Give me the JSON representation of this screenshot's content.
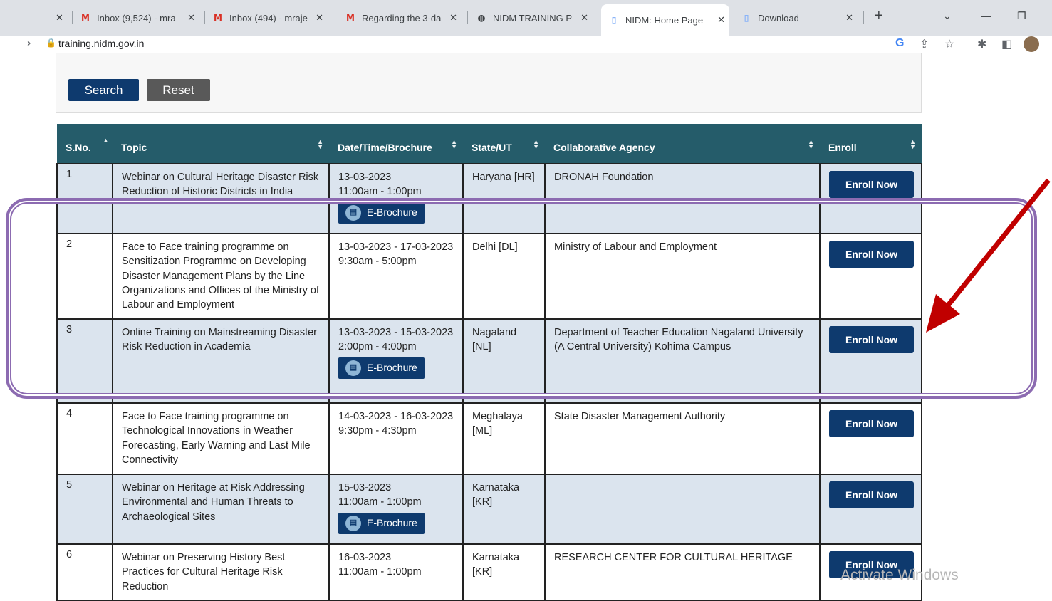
{
  "browser": {
    "tabs": [
      {
        "title": "Inbox (9,524) - mra",
        "icon": "gmail-icon"
      },
      {
        "title": "Inbox (494) - mraje",
        "icon": "gmail-icon"
      },
      {
        "title": "Regarding the 3-da",
        "icon": "gmail-icon"
      },
      {
        "title": "NIDM TRAINING P",
        "icon": "globe-icon"
      },
      {
        "title": "NIDM: Home Page",
        "icon": "page-icon"
      },
      {
        "title": "Download",
        "icon": "page-icon"
      }
    ],
    "url": "training.nidm.gov.in"
  },
  "search": {
    "search_label": "Search",
    "reset_label": "Reset"
  },
  "table": {
    "headers": [
      "S.No.",
      "Topic",
      "Date/Time/Brochure",
      "State/UT",
      "Collaborative Agency",
      "Enroll"
    ],
    "enroll_label": "Enroll Now",
    "brochure_label": "E-Brochure",
    "rows": [
      {
        "sno": "1",
        "topic": "Webinar on Cultural Heritage Disaster Risk Reduction of Historic Districts in India",
        "date": "13-03-2023",
        "time": "11:00am - 1:00pm",
        "brochure": true,
        "state": "Haryana [HR]",
        "agency": "DRONAH Foundation"
      },
      {
        "sno": "2",
        "topic": "Face to Face training programme on Sensitization Programme on Developing Disaster Management Plans by the Line Organizations and Offices of the Ministry of Labour and Employment",
        "date": "13-03-2023 - 17-03-2023",
        "time": "9:30am - 5:00pm",
        "brochure": false,
        "state": "Delhi [DL]",
        "agency": "Ministry of Labour and Employment"
      },
      {
        "sno": "3",
        "topic": "Online Training on Mainstreaming Disaster Risk Reduction in Academia",
        "date": "13-03-2023 - 15-03-2023",
        "time": "2:00pm - 4:00pm",
        "brochure": true,
        "state": "Nagaland [NL]",
        "agency": "Department of Teacher Education Nagaland University (A Central University) Kohima Campus"
      },
      {
        "sno": "4",
        "topic": "Face to Face training programme on Technological Innovations in Weather Forecasting, Early Warning and Last Mile Connectivity",
        "date": "14-03-2023 - 16-03-2023",
        "time": "9:30pm - 4:30pm",
        "brochure": false,
        "state": "Meghalaya [ML]",
        "agency": "State Disaster Management Authority"
      },
      {
        "sno": "5",
        "topic": "Webinar on Heritage at Risk Addressing Environmental and Human Threats to Archaeological Sites",
        "date": "15-03-2023",
        "time": "11:00am - 1:00pm",
        "brochure": true,
        "state": "Karnataka [KR]",
        "agency": ""
      },
      {
        "sno": "6",
        "topic": "Webinar on Preserving History Best Practices for Cultural Heritage Risk Reduction",
        "date": "16-03-2023",
        "time": "11:00am - 1:00pm",
        "brochure": false,
        "state": "Karnataka [KR]",
        "agency": "RESEARCH CENTER FOR CULTURAL HERITAGE"
      }
    ]
  },
  "annotation": {
    "highlight_color": "#8c6bb1",
    "arrow_color": "#c00000"
  },
  "watermark": "Activate Windows"
}
